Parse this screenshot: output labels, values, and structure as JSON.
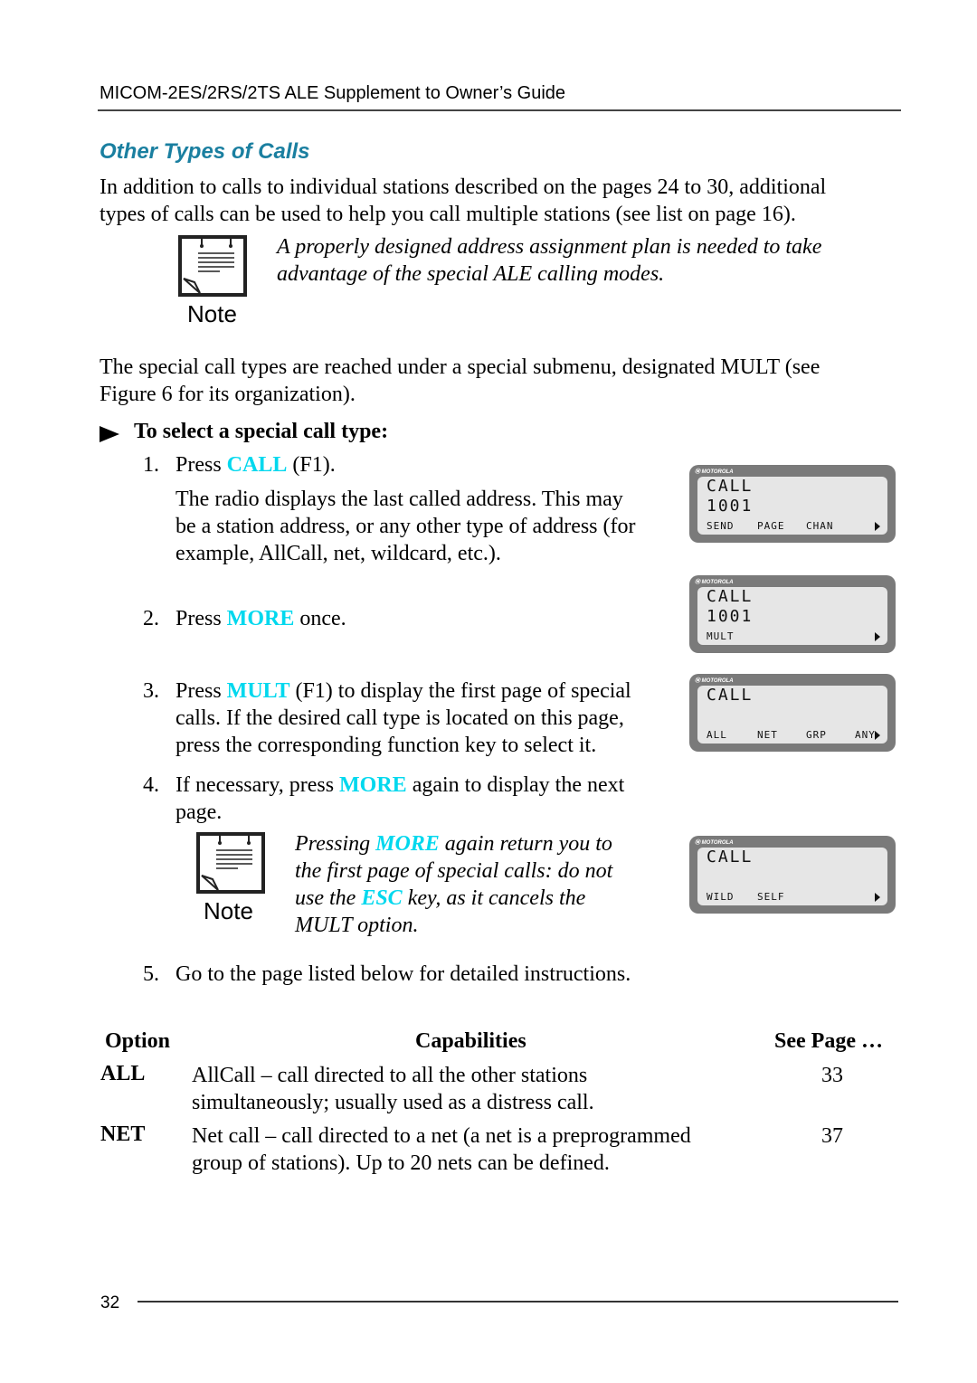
{
  "header": {
    "title": "MICOM-2ES/2RS/2TS ALE Supplement to Owner’s Guide"
  },
  "section": {
    "title": "Other Types of Calls"
  },
  "intro": {
    "line1": "In addition to calls to individual stations described on the pages 24 to 30, additional",
    "line2": "types of calls can be used to help you call multiple stations (see list on page 16)."
  },
  "note1": {
    "label": "Note",
    "icon": "note-pad-icon",
    "line1": "A properly designed address assignment plan is needed to take",
    "line2": "advantage of the special ALE calling modes."
  },
  "submenu_para": {
    "line1": "The special call types are reached under a special submenu, designated MULT (see",
    "line2": "Figure 6 for its organization)."
  },
  "procedure": {
    "bullet_icon": "arrow-bullet-icon",
    "title": "To select a special call type:",
    "steps": [
      {
        "num": "1.",
        "pre": "Press ",
        "key": "CALL",
        "post": " (F1).",
        "detail": [
          "The radio displays the last called address. This may",
          "be a station address, or any other type of address (for",
          "example, AllCall, net, wildcard, etc.)."
        ]
      },
      {
        "num": "2.",
        "pre": "Press ",
        "key": "MORE",
        "post": " once."
      },
      {
        "num": "3.",
        "pre": "Press ",
        "key": "MULT",
        "post": " (F1) to display the first page of special",
        "cont": [
          "calls. If the desired call type is located on this page,",
          "press the corresponding function key to select it."
        ]
      },
      {
        "num": "4.",
        "pre": "If necessary, press ",
        "key": "MORE",
        "post": " again to display the next",
        "cont": [
          "page."
        ]
      },
      {
        "num": "5.",
        "text": "Go to the page listed below for detailed instructions."
      }
    ]
  },
  "note2": {
    "label": "Note",
    "line1_pre": "Pressing ",
    "line1_key": "MORE",
    "line1_post": " again return you to",
    "line2": "the first page of special calls: do not",
    "line3_pre": "use the ",
    "line3_key": "ESC",
    "line3_post": " key, as it cancels the",
    "line4": "MULT option."
  },
  "lcd_displays": [
    {
      "brand": "MOTOROLA",
      "line1": "CALL",
      "line2": "1001",
      "keys": [
        "SEND",
        "PAGE",
        "CHAN"
      ],
      "more_arrow": true
    },
    {
      "brand": "MOTOROLA",
      "line1": "CALL",
      "line2": "1001",
      "keys": [
        "MULT"
      ],
      "more_arrow": true
    },
    {
      "brand": "MOTOROLA",
      "line1": "CALL",
      "line2": "",
      "keys": [
        "ALL",
        "NET",
        "GRP",
        "ANY"
      ],
      "more_arrow": true
    },
    {
      "brand": "MOTOROLA",
      "line1": "CALL",
      "line2": "",
      "keys": [
        "WILD",
        "SELF"
      ],
      "more_arrow": true
    }
  ],
  "table": {
    "headers": {
      "option": "Option",
      "capabilities": "Capabilities",
      "see_page": "See Page …"
    },
    "rows": [
      {
        "option": "ALL",
        "capabilities": [
          "AllCall – call directed to all the other stations",
          "simultaneously; usually used as a distress call."
        ],
        "page": "33"
      },
      {
        "option": "NET",
        "capabilities": [
          "Net call – call directed to a net (a net is a preprogrammed",
          "group of stations). Up to 20 nets can be defined."
        ],
        "page": "37"
      }
    ]
  },
  "footer": {
    "page_number": "32"
  },
  "colors": {
    "heading": "#1a7fa0",
    "key_highlight": "#00d8ee",
    "lcd_bezel": "#7a7a7a",
    "lcd_screen": "#e6e6e6"
  }
}
